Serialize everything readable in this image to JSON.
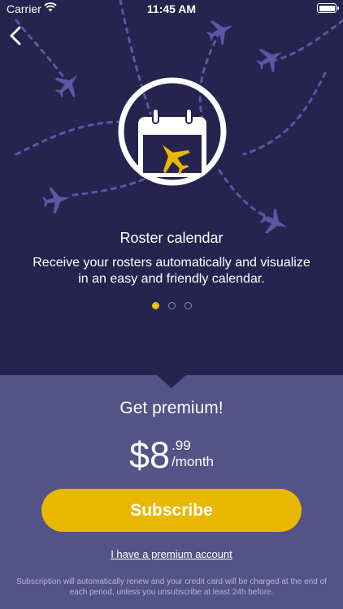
{
  "status_bar": {
    "carrier": "Carrier",
    "time": "11:45 AM",
    "wifi_icon": "wifi-icon",
    "battery_icon": "battery-icon"
  },
  "nav": {
    "back_icon": "chevron-left-icon"
  },
  "feature": {
    "icon": "calendar-plane-icon",
    "title": "Roster calendar",
    "description": "Receive your rosters automatically and visualize in an easy and friendly calendar.",
    "page_count": 3,
    "active_page": 0
  },
  "premium": {
    "title": "Get premium!",
    "price_main": "$8",
    "price_cents": ".99",
    "price_period": "/month",
    "subscribe_label": "Subscribe",
    "premium_account_link": "I have a premium account",
    "legal_text": "Subscription will automatically renew and your credit card will be charged at the end of each period, unless you unsubscribe at least 24h before."
  },
  "colors": {
    "hero_bg": "#26234f",
    "panel_bg": "#545286",
    "accent_yellow": "#e8b800",
    "decor_purple": "#5a57a3"
  }
}
